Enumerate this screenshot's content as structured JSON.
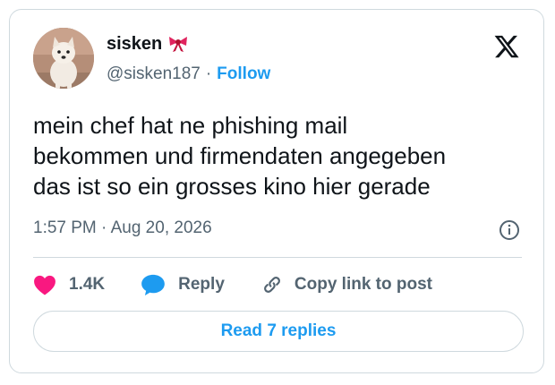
{
  "author": {
    "display_name": "sisken",
    "handle": "@sisken187",
    "separator": "·",
    "follow_label": "Follow"
  },
  "tweet": {
    "lines": [
      "mein chef hat ne phishing mail",
      "bekommen und firmendaten angegeben",
      "das ist so ein grosses kino hier gerade"
    ],
    "timestamp": "1:57 PM · Aug 20, 2026"
  },
  "actions": {
    "likes_count": "1.4K",
    "reply_label": "Reply",
    "copy_link_label": "Copy link to post"
  },
  "read_replies_label": "Read 7 replies",
  "colors": {
    "accent": "#1d9bf0",
    "like_heart": "#f91880",
    "text_primary": "#0f1419",
    "text_secondary": "#536471",
    "border": "#cfd9de"
  },
  "icons": {
    "name_emoji": "ribbon-icon",
    "brand": "x-logo-icon",
    "info": "info-icon",
    "like": "heart-icon",
    "reply": "speech-bubble-icon",
    "copy": "link-icon"
  }
}
